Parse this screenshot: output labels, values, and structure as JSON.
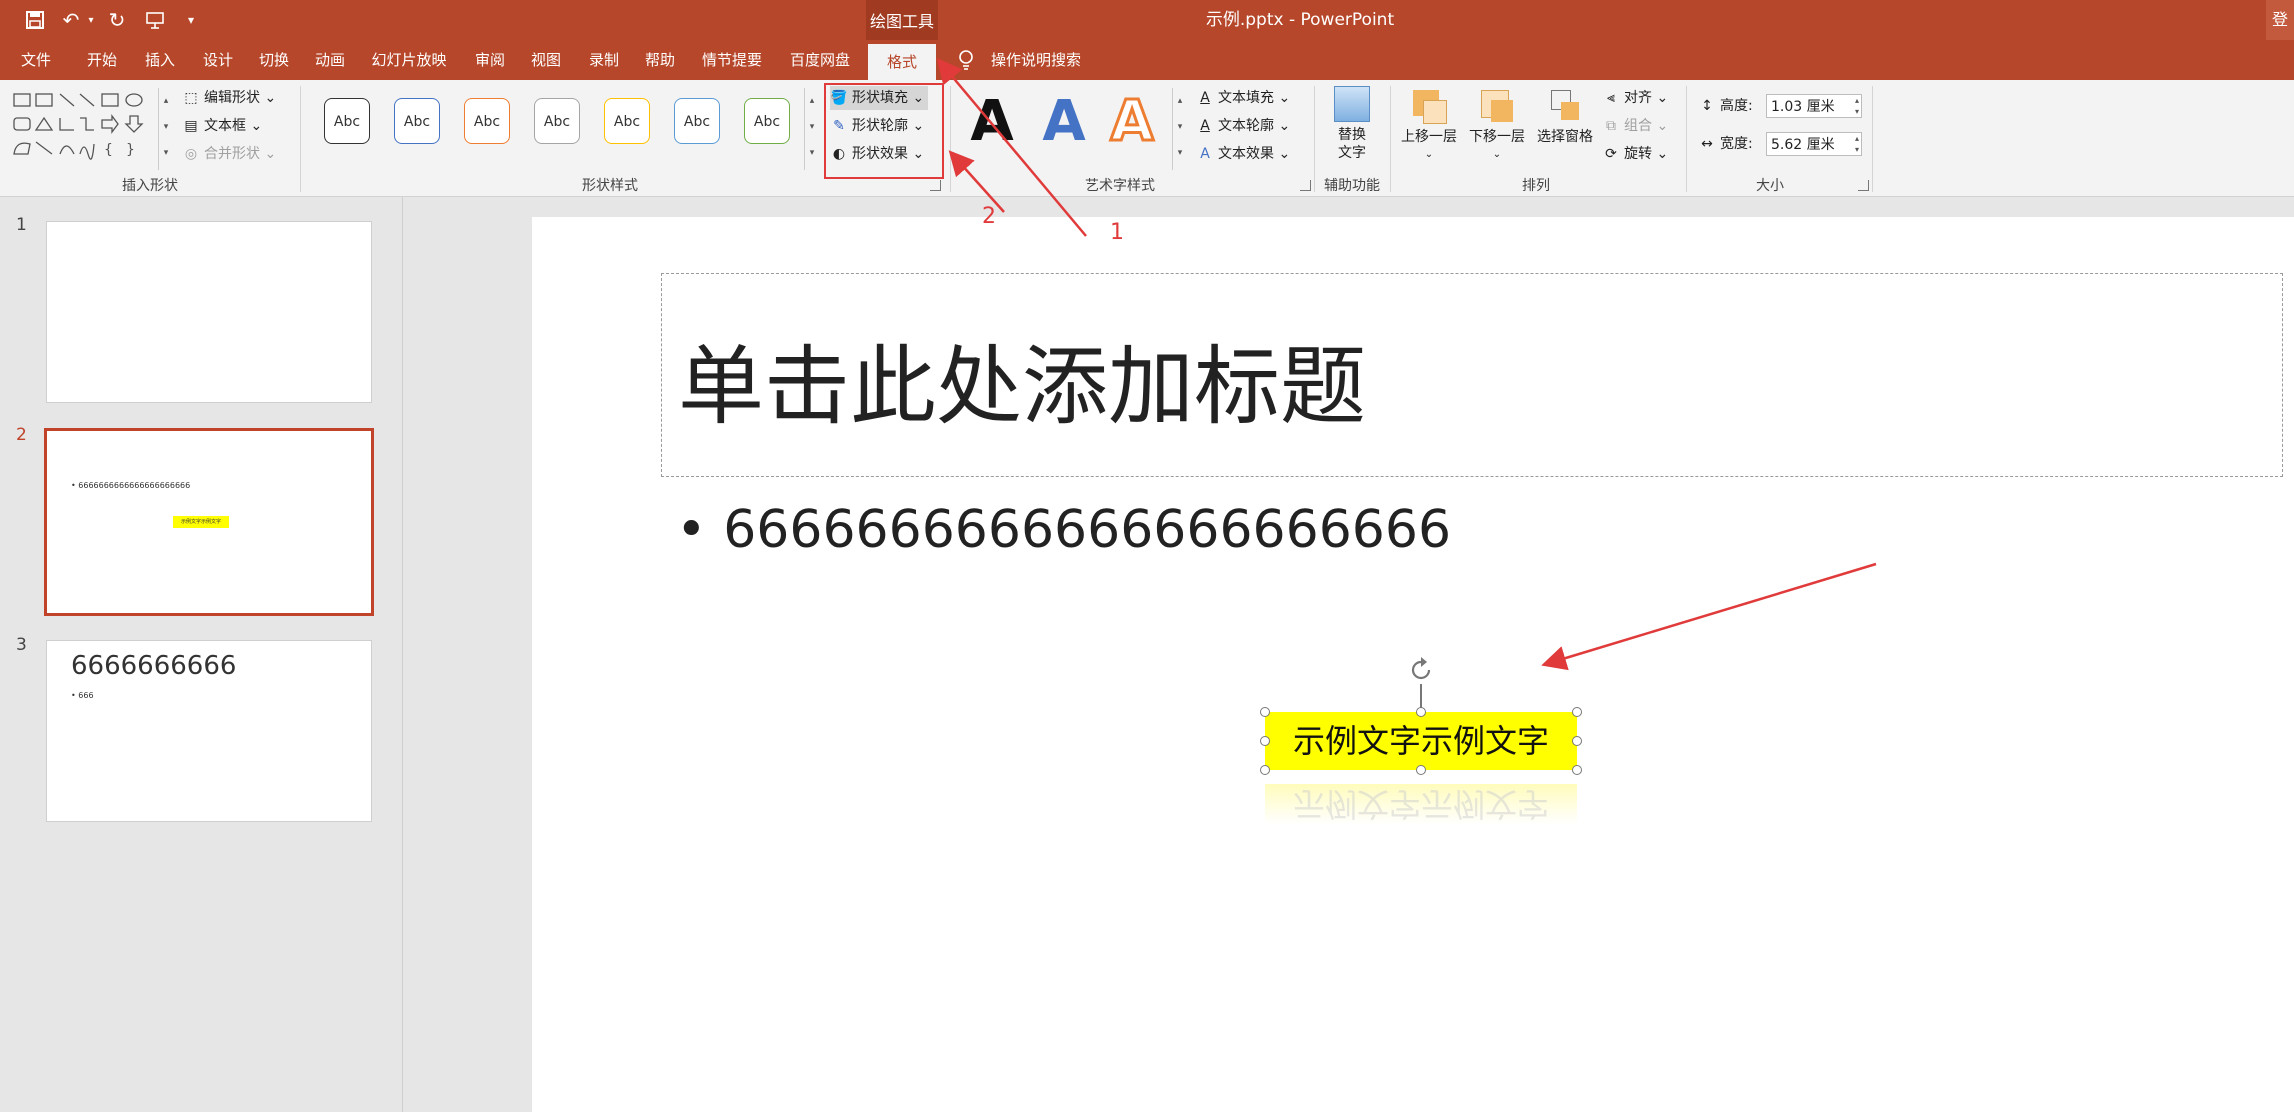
{
  "titlebar": {
    "context_tab": "绘图工具",
    "window_title": "示例.pptx  -  PowerPoint",
    "login": "登",
    "quick_access": [
      "save-icon",
      "undo-icon",
      "redo-icon",
      "present-icon",
      "customize-icon"
    ]
  },
  "tabs": [
    "文件",
    "开始",
    "插入",
    "设计",
    "切换",
    "动画",
    "幻灯片放映",
    "审阅",
    "视图",
    "录制",
    "帮助",
    "情节提要",
    "百度网盘",
    "格式"
  ],
  "active_tab": "格式",
  "tell_me": "操作说明搜索",
  "ribbon": {
    "insert_shapes": {
      "label": "插入形状",
      "edit_shape": "编辑形状",
      "text_box": "文本框",
      "merge_shapes": "合并形状"
    },
    "shape_styles": {
      "label": "形状样式",
      "thumb_text": "Abc",
      "thumb_colors": [
        "#333333",
        "#4472c4",
        "#ed7d31",
        "#a5a5a5",
        "#ffc000",
        "#5b9bd5",
        "#70ad47"
      ],
      "shape_fill": "形状填充",
      "shape_outline": "形状轮廓",
      "shape_effects": "形状效果"
    },
    "wordart_styles": {
      "label": "艺术字样式",
      "letter": "A",
      "text_fill": "文本填充",
      "text_outline": "文本轮廓",
      "text_effects": "文本效果"
    },
    "accessibility": {
      "label": "辅助功能",
      "alt_text_line1": "替换",
      "alt_text_line2": "文字"
    },
    "arrange": {
      "label": "排列",
      "bring_forward": "上移一层",
      "send_backward": "下移一层",
      "selection_pane": "选择窗格",
      "align": "对齐",
      "group": "组合",
      "rotate": "旋转"
    },
    "size": {
      "label": "大小",
      "height_label": "高度:",
      "height_value": "1.03 厘米",
      "width_label": "宽度:",
      "width_value": "5.62 厘米"
    }
  },
  "slides": [
    {
      "number": "1"
    },
    {
      "number": "2",
      "bullet": "• 6666666666666666666666",
      "box": "示例文字示例文字"
    },
    {
      "number": "3",
      "title": "6666666666",
      "bullet": "• 666"
    }
  ],
  "canvas": {
    "title_placeholder": "单击此处添加标题",
    "bullet_text": "6666666666666666666666",
    "textbox_text": "示例文字示例文字"
  },
  "annotations": [
    "1",
    "2"
  ],
  "colors": {
    "accent": "#b7472a",
    "annotation": "#e03a3a",
    "textbox_fill": "#ffff00"
  }
}
